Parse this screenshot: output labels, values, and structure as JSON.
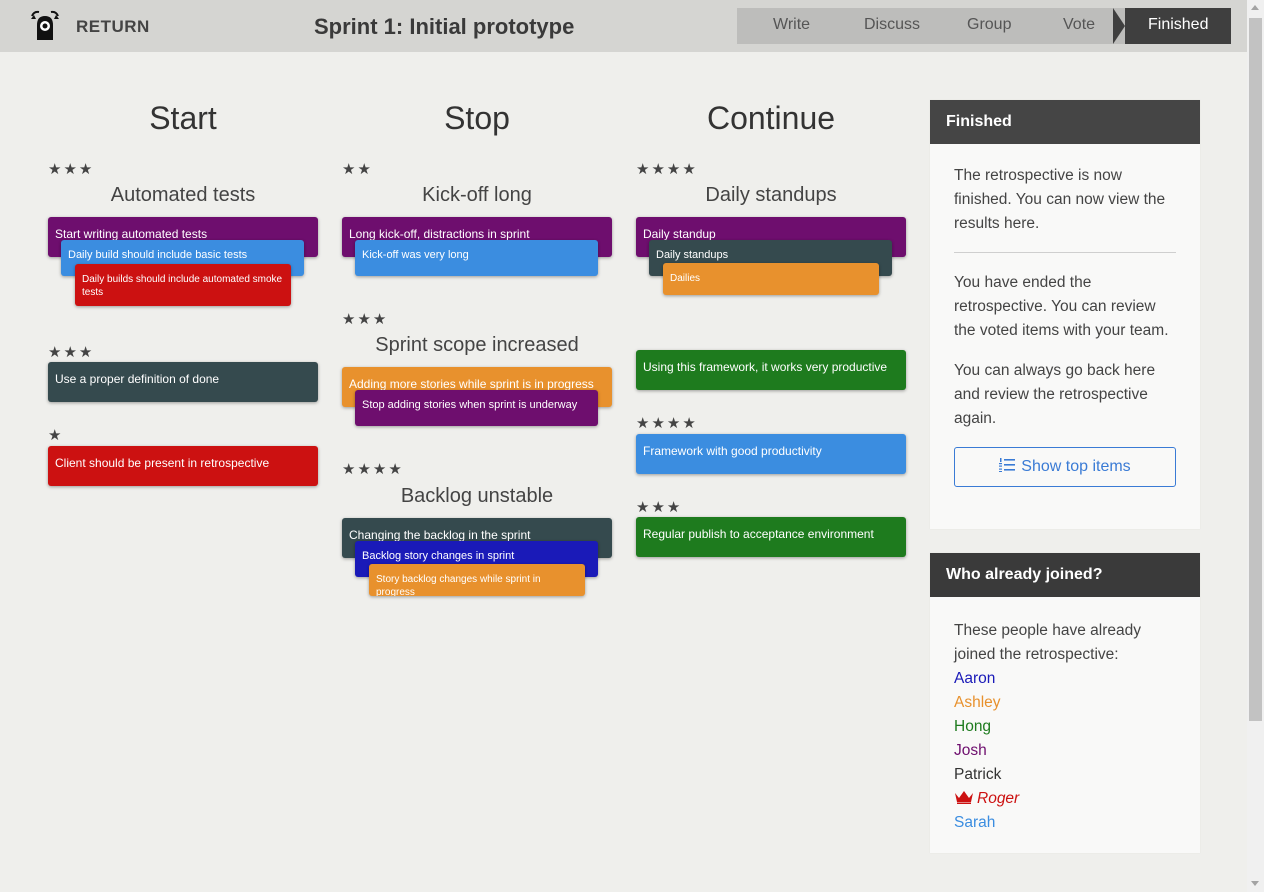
{
  "header": {
    "return_label": "RETURN",
    "sprint_title": "Sprint 1: Initial prototype",
    "stages": [
      "Write",
      "Discuss",
      "Group",
      "Vote",
      "Finished"
    ],
    "active_stage": "Finished"
  },
  "columns": {
    "start": {
      "title": "Start",
      "groups": [
        {
          "stars": "★★★",
          "title": "Automated tests",
          "cards": [
            "Start writing automated tests",
            "Daily build should include basic tests",
            "Daily builds should include automated smoke tests"
          ]
        },
        {
          "stars": "★★★",
          "title": "",
          "cards": [
            "Use a proper definition of done"
          ]
        },
        {
          "stars": "★",
          "title": "",
          "cards": [
            "Client should be present in retrospective"
          ]
        }
      ]
    },
    "stop": {
      "title": "Stop",
      "groups": [
        {
          "stars": "★★",
          "title": "Kick-off long",
          "cards": [
            "Long kick-off, distractions in sprint",
            "Kick-off was very long"
          ]
        },
        {
          "stars": "★★★",
          "title": "Sprint scope increased",
          "cards": [
            "Adding more stories while sprint is in progress",
            "Stop adding stories when sprint is underway"
          ]
        },
        {
          "stars": "★★★★",
          "title": "Backlog unstable",
          "cards": [
            "Changing the backlog in the sprint",
            "Backlog story changes in sprint",
            "Story backlog changes while sprint in progress"
          ]
        }
      ]
    },
    "continue": {
      "title": "Continue",
      "groups": [
        {
          "stars": "★★★★",
          "title": "Daily standups",
          "cards": [
            "Daily standup",
            "Daily standups",
            "Dailies"
          ]
        },
        {
          "stars": "",
          "title": "",
          "cards": [
            "Using this framework, it works very productive"
          ]
        },
        {
          "stars": "★★★★",
          "title": "",
          "cards": [
            "Framework with good productivity"
          ]
        },
        {
          "stars": "★★★",
          "title": "",
          "cards": [
            "Regular publish to acceptance environment"
          ]
        }
      ]
    }
  },
  "sidebar": {
    "finished": {
      "heading": "Finished",
      "para1": "The retrospective is now finished. You can now view the results here.",
      "para2": "You have ended the retrospective. You can review the voted items with your team.",
      "para3": "You can always go back here and review the retrospective again.",
      "button_label": "Show top items"
    },
    "joined": {
      "heading": "Who already joined?",
      "intro": "These people have already joined the retrospective:",
      "participants": [
        {
          "name": "Aaron",
          "color": "#1a1ab8"
        },
        {
          "name": "Ashley",
          "color": "#e8912d"
        },
        {
          "name": "Hong",
          "color": "#1e7b1e"
        },
        {
          "name": "Josh",
          "color": "#6e0e6e"
        },
        {
          "name": "Patrick",
          "color": "#333333"
        },
        {
          "name": "Roger",
          "color": "#cc1111"
        },
        {
          "name": "Sarah",
          "color": "#3b8de0"
        }
      ]
    }
  },
  "colors": {
    "purple": "#6e0e6e",
    "blue": "#3b8de0",
    "red": "#cc1111",
    "slate": "#354a4e",
    "orange": "#e8912d",
    "green": "#1e7b1e",
    "navy": "#1a1ab8",
    "panel_dark": "#454545"
  }
}
